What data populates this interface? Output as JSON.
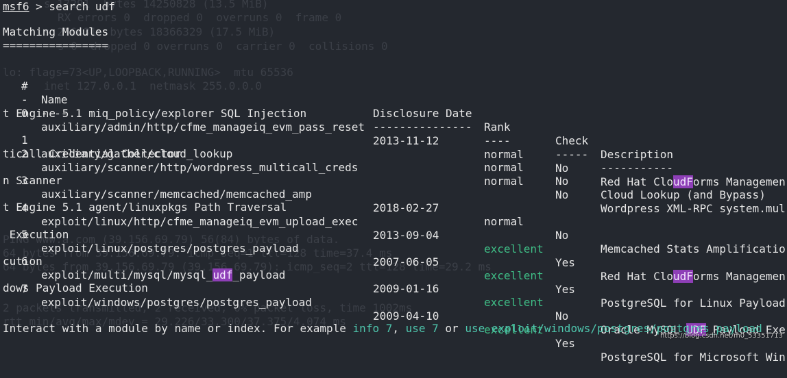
{
  "prompt": {
    "prefix": "msf6",
    "command": " > search udf"
  },
  "heading": "Matching Modules",
  "heading_rule": "================",
  "table": {
    "columns": {
      "num": "#",
      "name": "Name",
      "date": "Disclosure Date",
      "rank": "Rank",
      "check": "Check",
      "desc": "Description"
    },
    "dashes": {
      "num": "-",
      "name": "----",
      "date": "---------------",
      "rank": "----",
      "check": "-----",
      "desc": "-----------"
    },
    "rows": [
      {
        "index": "0",
        "name": "auxiliary/admin/http/cfme_manageiq_evm_pass_reset",
        "date": "2013-11-12",
        "rank": "normal",
        "check": "No",
        "desc_pre": "Red Hat Clo",
        "desc_hl": "udF",
        "desc_post": "orms Managemen",
        "wrap": "t Engine 5.1 miq_policy/explorer SQL Injection"
      },
      {
        "index": "1",
        "name": "auxiliary/gather/cloud_lookup",
        "date": "",
        "rank": "normal",
        "check": "No",
        "desc": "Cloud Lookup (and Bypass)"
      },
      {
        "index": "2",
        "name": "auxiliary/scanner/http/wordpress_multicall_creds",
        "date": "",
        "rank": "normal",
        "check": "No",
        "desc": "Wordpress XML-RPC system.mul",
        "wrap": "ticall Credential Collector"
      },
      {
        "index": "3",
        "name": "auxiliary/scanner/memcached/memcached_amp",
        "date": "2018-02-27",
        "rank": "normal",
        "check": "No",
        "desc": "Memcached Stats Amplificatio",
        "wrap": "n Scanner"
      },
      {
        "index": "4",
        "name": "exploit/linux/http/cfme_manageiq_evm_upload_exec",
        "date": "2013-09-04",
        "rank": "excellent",
        "check": "Yes",
        "desc_pre": "Red Hat Clo",
        "desc_hl": "udF",
        "desc_post": "orms Managemen",
        "wrap": "t Engine 5.1 agent/linuxpkgs Path Traversal"
      },
      {
        "index": "5",
        "name": "exploit/linux/postgres/postgres_payload",
        "date": "2007-06-05",
        "rank": "excellent",
        "check": "Yes",
        "desc": "PostgreSQL for Linux Payload",
        "wrap": " Execution"
      },
      {
        "index": "6",
        "name_pre": "exploit/multi/mysql/mysql_",
        "name_hl": "udf",
        "name_post": "_payload",
        "date": "2009-01-16",
        "rank": "excellent",
        "check": "No",
        "desc_pre": "Oracle MySQL ",
        "desc_hl": "UDF",
        "desc_post": " Payload Exe",
        "wrap": "cution"
      },
      {
        "index": "7",
        "name": "exploit/windows/postgres/postgres_payload",
        "date": "2009-04-10",
        "rank": "excellent",
        "check": "Yes",
        "desc": "PostgreSQL for Microsoft Win",
        "wrap": "dows Payload Execution"
      }
    ]
  },
  "footer": {
    "pre": "Interact with a module by name or index. For example ",
    "info": "info 7",
    "sep1": ", ",
    "use": "use 7",
    "sep2": " or ",
    "use_full": "use exploit/windows/postgres/postgres_payload"
  },
  "watermark": "https://blog.csdn.net/m0_53351713",
  "colors": {
    "background": "#24282f",
    "text": "#e6e6e6",
    "excellent": "#3fbf87",
    "link": "#4fc7ae",
    "highlight": "#8e3fb7"
  }
}
